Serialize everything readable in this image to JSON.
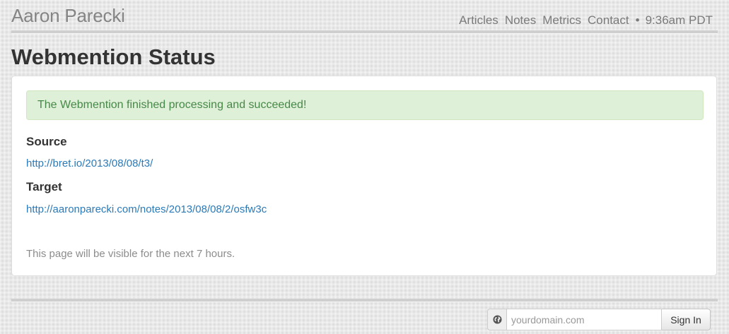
{
  "header": {
    "site_title": "Aaron Parecki",
    "nav": {
      "articles": "Articles",
      "notes": "Notes",
      "metrics": "Metrics",
      "contact": "Contact",
      "separator": "•",
      "time": "9:36am PDT"
    }
  },
  "page": {
    "title": "Webmention Status"
  },
  "status": {
    "message": "The Webmention finished processing and succeeded!",
    "source_label": "Source",
    "source_url": "http://bret.io/2013/08/08/t3/",
    "target_label": "Target",
    "target_url": "http://aaronparecki.com/notes/2013/08/08/2/osfw3c",
    "visibility_note": "This page will be visible for the next 7 hours."
  },
  "footer": {
    "globe_icon": "globe-icon",
    "domain_placeholder": "yourdomain.com",
    "signin_label": "Sign In"
  },
  "colors": {
    "link": "#2a7ab8",
    "success_bg": "#dff0d8",
    "success_text": "#468847",
    "muted_text": "#8c8c8c"
  }
}
